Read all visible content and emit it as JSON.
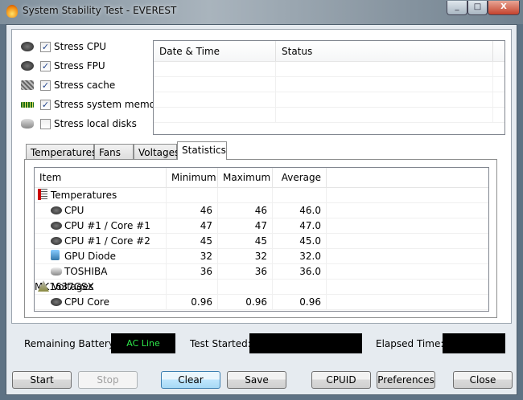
{
  "window": {
    "title": "System Stability Test - EVEREST",
    "minimize": "_",
    "maximize": "□",
    "close": "X"
  },
  "stress": [
    {
      "label": "Stress CPU",
      "checked": true,
      "icon": "cpu-icon"
    },
    {
      "label": "Stress FPU",
      "checked": true,
      "icon": "fpu-icon"
    },
    {
      "label": "Stress cache",
      "checked": true,
      "icon": "cache-icon"
    },
    {
      "label": "Stress system memory",
      "checked": true,
      "icon": "memory-icon"
    },
    {
      "label": "Stress local disks",
      "checked": false,
      "icon": "disk-icon"
    }
  ],
  "log": {
    "columns": [
      "Date & Time",
      "Status"
    ]
  },
  "tabs": [
    "Temperatures",
    "Fans",
    "Voltages",
    "Statistics"
  ],
  "stats": {
    "columns": [
      "Item",
      "Minimum",
      "Maximum",
      "Average"
    ],
    "groups": [
      {
        "name": "Temperatures",
        "rows": [
          {
            "item": "CPU",
            "min": "46",
            "max": "46",
            "avg": "46.0"
          },
          {
            "item": "CPU #1 / Core #1",
            "min": "47",
            "max": "47",
            "avg": "47.0"
          },
          {
            "item": "CPU #1 / Core #2",
            "min": "45",
            "max": "45",
            "avg": "45.0"
          },
          {
            "item": "GPU Diode",
            "min": "32",
            "max": "32",
            "avg": "32.0"
          },
          {
            "item": "TOSHIBA MK1637GSX",
            "min": "36",
            "max": "36",
            "avg": "36.0"
          }
        ]
      },
      {
        "name": "Voltages",
        "rows": [
          {
            "item": "CPU Core",
            "min": "0.96",
            "max": "0.96",
            "avg": "0.96"
          }
        ]
      }
    ]
  },
  "status": {
    "battery_label": "Remaining Battery:",
    "battery_value": "AC Line",
    "test_started_label": "Test Started:",
    "test_started_value": "",
    "elapsed_label": "Elapsed Time:",
    "elapsed_value": ""
  },
  "buttons": {
    "start": "Start",
    "stop": "Stop",
    "clear": "Clear",
    "save": "Save",
    "cpuid": "CPUID",
    "preferences": "Preferences",
    "close": "Close"
  }
}
